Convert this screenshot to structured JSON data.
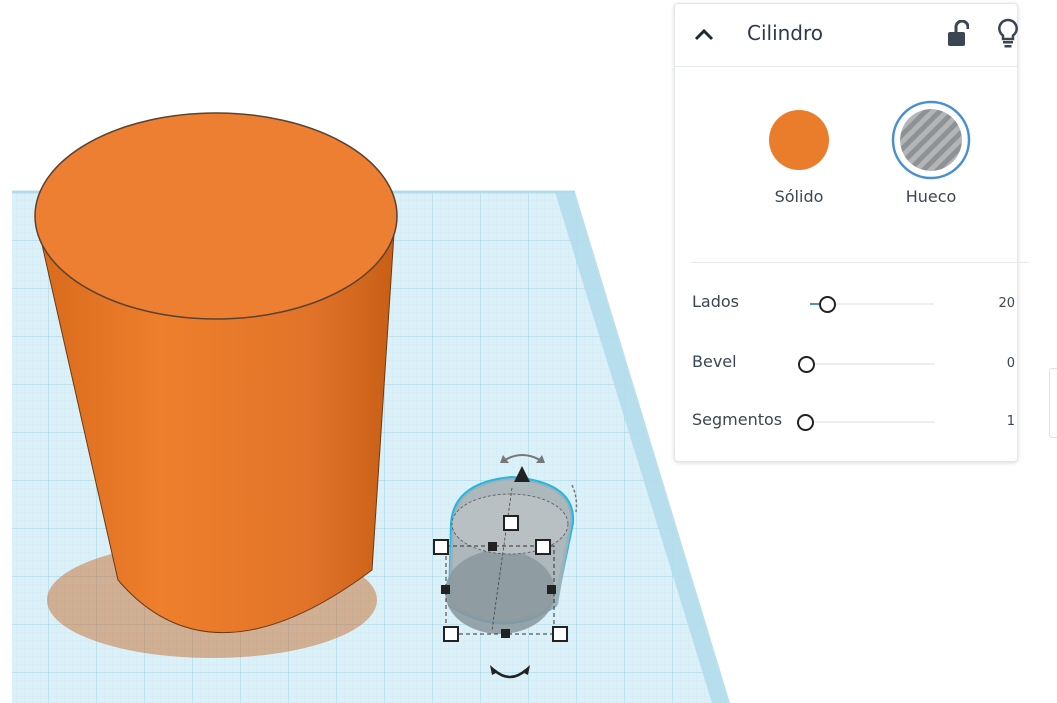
{
  "shape_panel": {
    "title": "Cilindro",
    "options": [
      {
        "label": "Sólido",
        "color": "#e97d2c"
      },
      {
        "label": "Hueco",
        "color": "#a6a9ac"
      }
    ],
    "selected_outline_color": "#4a8fd0",
    "params": [
      {
        "label": "Lados",
        "value": "20"
      },
      {
        "label": "Bevel",
        "value": "0"
      },
      {
        "label": "Segmentos",
        "value": "1"
      }
    ],
    "icons": [
      "chevron-up-icon",
      "unlock-icon",
      "lightbulb-icon"
    ]
  },
  "workplane": {
    "grid_color": "#bfe3f0",
    "plane_color": "#d8eef7"
  },
  "objects": [
    {
      "name": "orange-cylinder",
      "color": "#e97d2c"
    },
    {
      "name": "hole-cylinder",
      "color": "#9aa3a8",
      "selected": true
    }
  ]
}
